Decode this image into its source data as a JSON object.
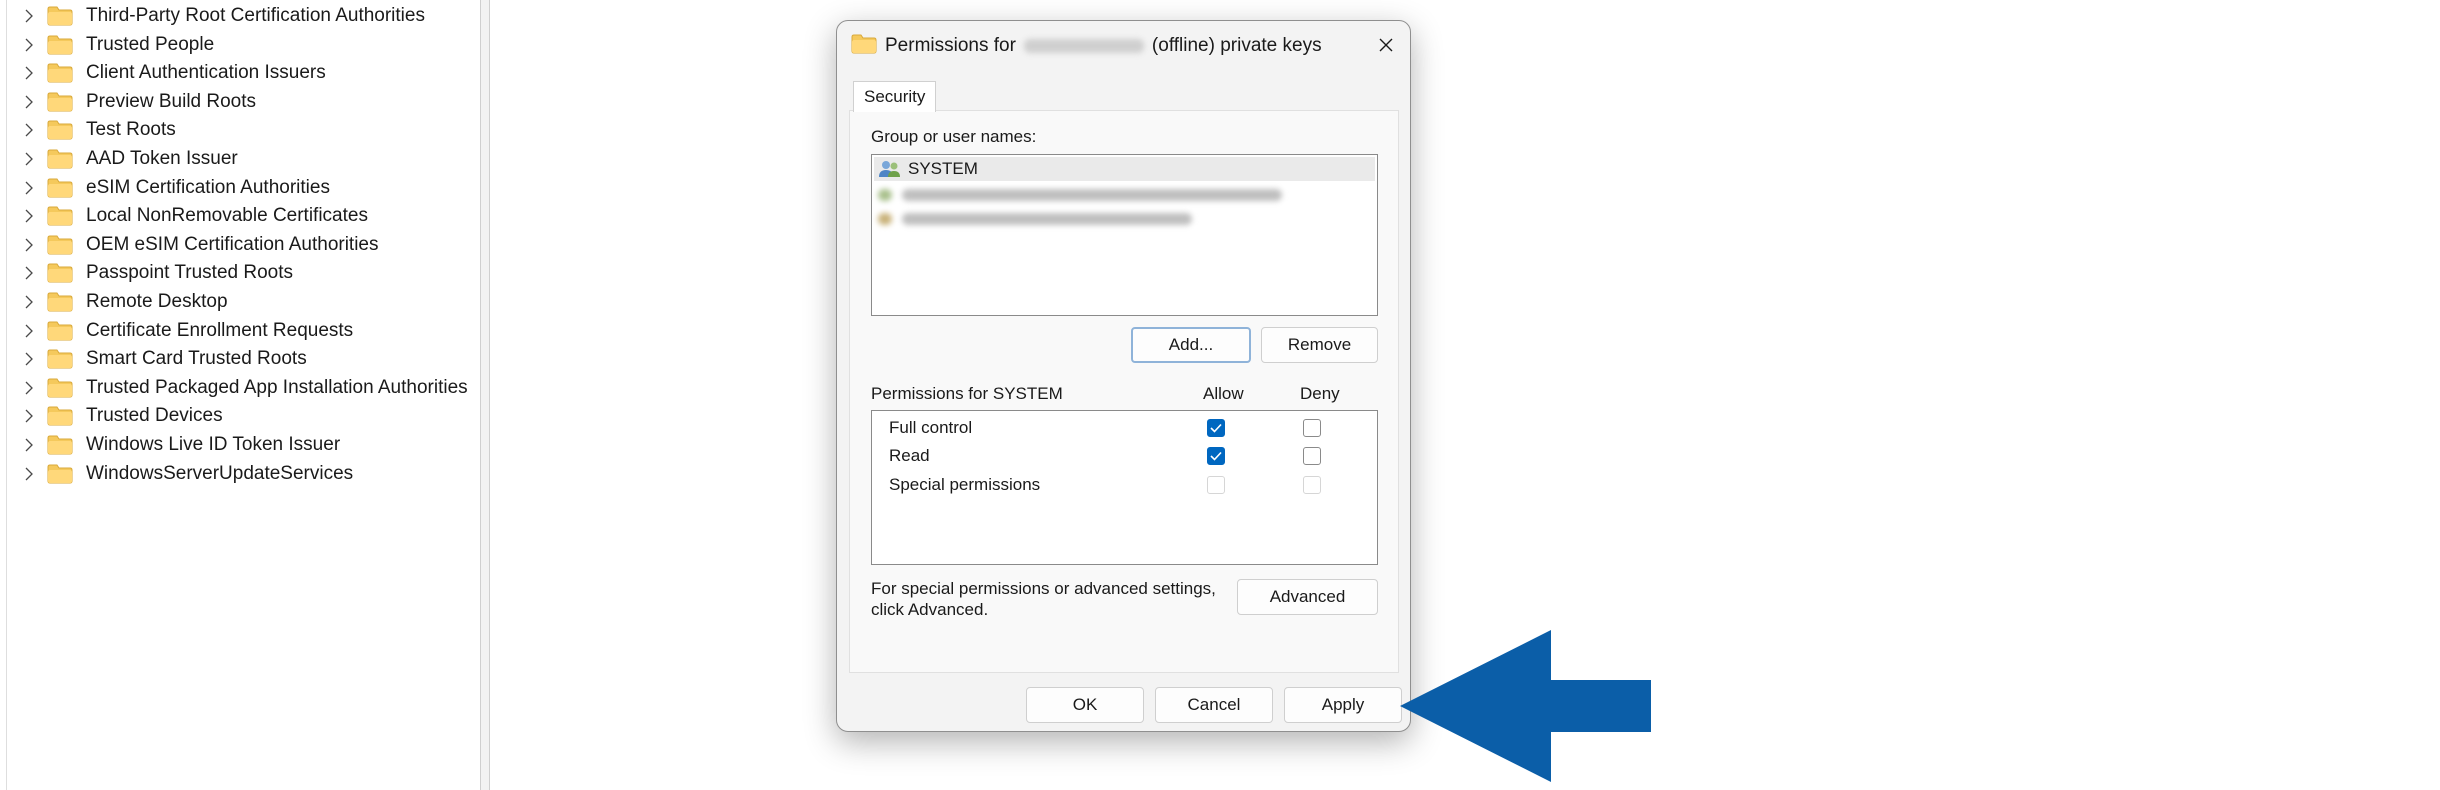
{
  "tree": {
    "items": [
      {
        "label": "Third-Party Root Certification Authorities"
      },
      {
        "label": "Trusted People"
      },
      {
        "label": "Client Authentication Issuers"
      },
      {
        "label": "Preview Build Roots"
      },
      {
        "label": "Test Roots"
      },
      {
        "label": "AAD Token Issuer"
      },
      {
        "label": "eSIM Certification Authorities"
      },
      {
        "label": "Local NonRemovable Certificates"
      },
      {
        "label": "OEM eSIM Certification Authorities"
      },
      {
        "label": "Passpoint Trusted Roots"
      },
      {
        "label": "Remote Desktop"
      },
      {
        "label": "Certificate Enrollment Requests"
      },
      {
        "label": "Smart Card Trusted Roots"
      },
      {
        "label": "Trusted Packaged App Installation Authorities"
      },
      {
        "label": "Trusted Devices"
      },
      {
        "label": "Windows Live ID Token Issuer"
      },
      {
        "label": "WindowsServerUpdateServices"
      }
    ]
  },
  "dialog": {
    "title_prefix": "Permissions for",
    "title_suffix": "(offline) private keys",
    "close_icon": "close-icon",
    "tab_label": "Security",
    "group_label": "Group or user names:",
    "users": [
      {
        "name": "SYSTEM",
        "selected": true
      }
    ],
    "add_label": "Add...",
    "remove_label": "Remove",
    "perm_header": "Permissions for SYSTEM",
    "allow_label": "Allow",
    "deny_label": "Deny",
    "permissions": [
      {
        "name": "Full control",
        "allow": true,
        "deny": false,
        "enabled": true
      },
      {
        "name": "Read",
        "allow": true,
        "deny": false,
        "enabled": true
      },
      {
        "name": "Special permissions",
        "allow": false,
        "deny": false,
        "enabled": false
      }
    ],
    "advanced_text_1": "For special permissions or advanced settings,",
    "advanced_text_2": "click Advanced.",
    "advanced_label": "Advanced",
    "ok_label": "OK",
    "cancel_label": "Cancel",
    "apply_label": "Apply"
  },
  "colors": {
    "accent": "#0067c0",
    "arrow": "#0b5ea8",
    "folder": "#f5c95c"
  }
}
